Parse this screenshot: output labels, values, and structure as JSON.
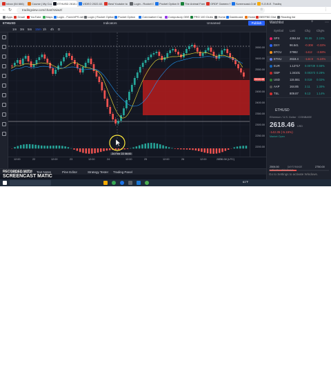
{
  "browser": {
    "tabs": [
      {
        "label": "Inbox (54 666)",
        "color": "#d93025"
      },
      {
        "label": "Course | My Cours",
        "color": "#e8710a"
      },
      {
        "label": "ETHUSD 2618.46",
        "color": "#131722",
        "active": true
      },
      {
        "label": "VIDEO 2022-02-27",
        "color": "#1a73e8"
      },
      {
        "label": "Best Youtube to Mo",
        "color": "#d93025"
      },
      {
        "label": "Login - Rocket Opti",
        "color": "#5f6368"
      },
      {
        "label": "Pocket Option MPA",
        "color": "#1a73e8"
      },
      {
        "label": "The Animal Farm",
        "color": "#188038"
      },
      {
        "label": "ORDF Gamerz N",
        "color": "#d93025"
      },
      {
        "label": "Screencast-O-Ma",
        "color": "#1a73e8"
      },
      {
        "label": "S.O.B.E. Trading",
        "color": "#f9ab00"
      }
    ],
    "address": "tradingview.com/chart/VaiwZ/",
    "bookmarks": [
      {
        "label": "Apps",
        "color": "#5f6368"
      },
      {
        "label": "Gmail",
        "color": "#d93025"
      },
      {
        "label": "YouTube",
        "color": "#ff0000"
      },
      {
        "label": "Maps",
        "color": "#34a853"
      },
      {
        "label": "Login - ForexVPS.net",
        "color": "#1a73e8"
      },
      {
        "label": "Login | Rocket Option",
        "color": "#5f6368"
      },
      {
        "label": "Pocket Option",
        "color": "#1a73e8"
      },
      {
        "label": "Coinmarket Cap",
        "color": "#1a73e8"
      },
      {
        "label": "Compulsory OBS",
        "color": "#9334e6"
      },
      {
        "label": "PRO 100 Clubs",
        "color": "#188038"
      },
      {
        "label": "Home",
        "color": "#5f6368"
      },
      {
        "label": "Dashboard",
        "color": "#1a73e8"
      },
      {
        "label": "Home",
        "color": "#e8710a"
      },
      {
        "label": "BEEFBD Dist",
        "color": "#d93025"
      },
      {
        "label": "Reading list",
        "color": "#5f6368"
      }
    ]
  },
  "toolbar": {
    "symbol": "ETHUSD",
    "timeframes": [
      "1m",
      "3m",
      "5m",
      "15m",
      "1h",
      "4h",
      "D"
    ],
    "indicators_label": "Indicators",
    "layout_name": "Unnamed",
    "publish_label": "Publish"
  },
  "chart": {
    "symbol_line": "Ethereum / U.S. Dollar · 15 · COINBASE",
    "price_labels": [
      "2650.00",
      "2600.00",
      "2550.00",
      "2500.00",
      "2450.00",
      "2400.00",
      "2350.00",
      "2300.00",
      "2250.00",
      "2200.00"
    ],
    "time_labels": [
      "12:00",
      "22",
      "12:00",
      "23",
      "12:00",
      "24",
      "12:00",
      "25",
      "12:00",
      "26",
      "12:00",
      "27"
    ],
    "current_price_tag": "2618.46",
    "crosshair_date": "24 Feb '22  06:00",
    "clock_readout": "20:36:38 (UTC)",
    "bottom_options": [
      "%",
      "log",
      "auto"
    ],
    "rsi_header": "CM_Ult_MacD_MTF 15 26 12 9"
  },
  "bottom_tabs": [
    "Stock Screener",
    "Text Notes",
    "Pine Editor",
    "Strategy Tester",
    "Trading Panel"
  ],
  "watchlist": {
    "title": "Watchlist",
    "headers": [
      "Symbol",
      "Last",
      "Chg",
      "Chg%"
    ],
    "rows": [
      {
        "sym": "SPX",
        "last": "4384.64",
        "chg": "95.95",
        "pct": "2.24%",
        "dir": "pos",
        "color": "#e91e63"
      },
      {
        "sym": "DXY",
        "last": "96.541",
        "chg": "-0.308",
        "pct": "-0.32%",
        "dir": "neg",
        "color": "#2962ff"
      },
      {
        "sym": "BTCU",
        "last": "37982",
        "chg": "-1412",
        "pct": "-3.58%",
        "dir": "neg",
        "color": "#f7931a"
      },
      {
        "sym": "ETHU",
        "last": "2618.4",
        "chg": "-144.9",
        "pct": "-5.24%",
        "dir": "neg",
        "color": "#627eea"
      },
      {
        "sym": "EUR",
        "last": "1.12717",
        "chg": "0.00739",
        "pct": "0.66%",
        "dir": "pos",
        "color": "#1565c0"
      },
      {
        "sym": "GBP",
        "last": "1.34101",
        "chg": "0.00373",
        "pct": "0.28%",
        "dir": "pos",
        "color": "#c62828"
      },
      {
        "sym": "USD",
        "last": "115.551",
        "chg": "0.019",
        "pct": "0.02%",
        "dir": "pos",
        "color": "#2e7d32"
      },
      {
        "sym": "AAP",
        "last": "164.85",
        "chg": "2.11",
        "pct": "1.30%",
        "dir": "pos",
        "color": "#555555"
      },
      {
        "sym": "TSL",
        "last": "809.87",
        "chg": "9.13",
        "pct": "1.14%",
        "dir": "pos",
        "color": "#d32f2f"
      }
    ],
    "detail_symbol": "ETHUSD",
    "detail_name": "Ethereum / U.S. Dollar · COINBASE",
    "detail_price": "2618.46",
    "detail_unit": "USD",
    "detail_change": "-142.35 (-5.15%)",
    "detail_status": "Market Open",
    "stats": [
      {
        "label": "2506.50",
        "sub": "DAY'S RANGE"
      },
      {
        "label": "2750.00",
        "sub": ""
      }
    ],
    "activate_title": "Activate Windows",
    "activate_sub": "Go to Settings to activate Windows."
  },
  "recording": {
    "line1": "RECORDED WITH",
    "line2": "SCREENCAST MATIC"
  },
  "taskbar": {
    "time": "3:36 PM",
    "date": "2022-02-27",
    "weather": "61°F"
  }
}
